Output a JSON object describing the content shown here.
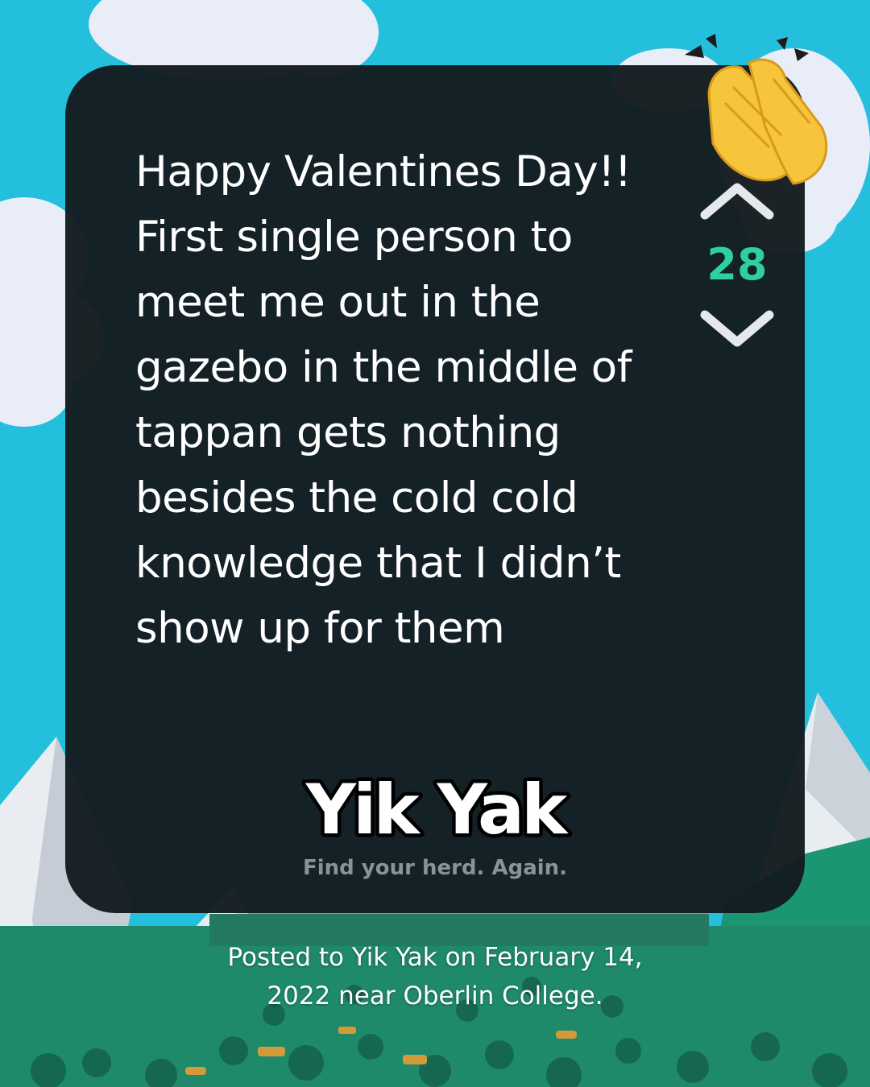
{
  "post": {
    "text": "Happy Valentines Day!!\nFirst single person to\nmeet me out in the\ngazebo in the middle of\ntappan gets nothing\nbesides the cold cold\nknowledge that I didn’t\nshow up for them",
    "vote_count": "28"
  },
  "brand": {
    "logo_text": "Yik Yak",
    "tagline": "Find your herd. Again."
  },
  "caption": "Posted to Yik Yak on February 14,\n2022 near Oberlin College.",
  "icons": {
    "upvote": "chevron-up-icon",
    "downvote": "chevron-down-icon",
    "emoji": "clapping-hands-icon"
  },
  "colors": {
    "background_sky": "#25bfde",
    "card": "#141c20",
    "vote_count": "#2fd0a0",
    "tagline": "#8b9398",
    "forest": "#1f8a6a"
  }
}
